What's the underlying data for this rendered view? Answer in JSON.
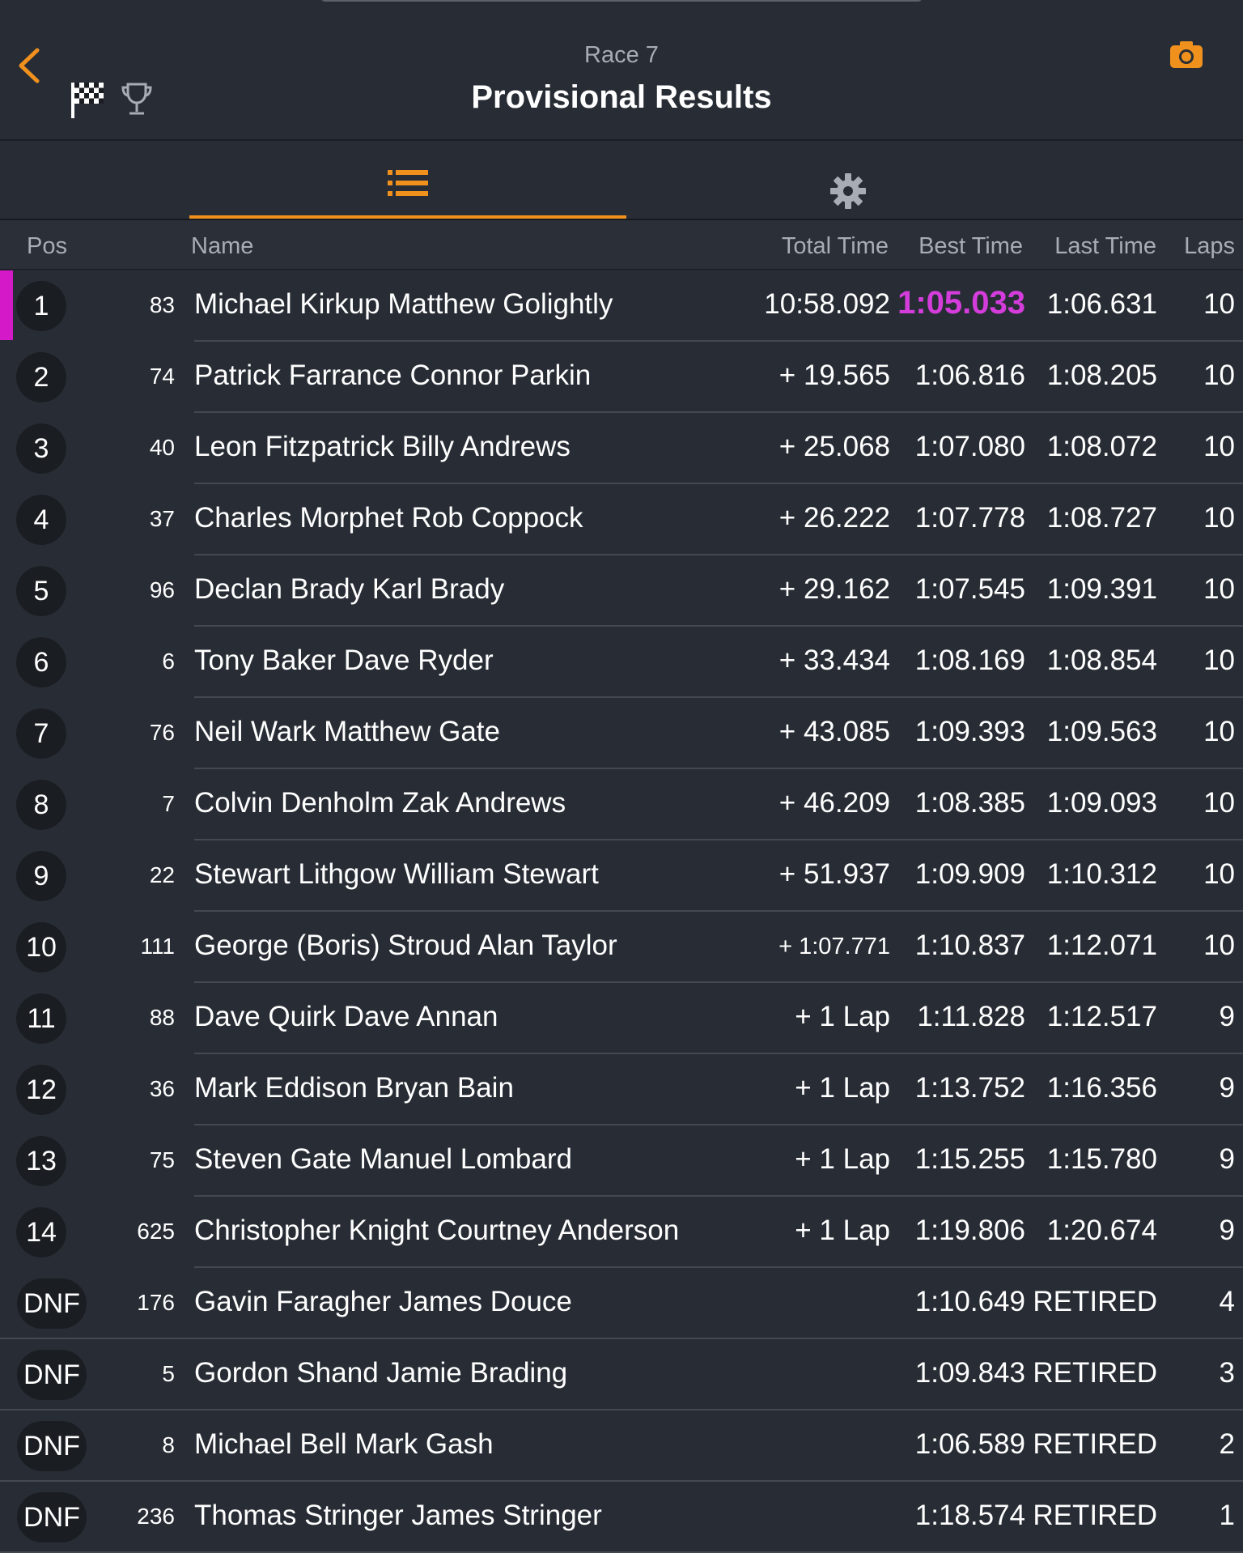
{
  "header": {
    "subtitle": "Race 7",
    "title": "Provisional Results"
  },
  "colors": {
    "accent": "#f0911e",
    "fastest": "#d43ddb",
    "background": "#282d35"
  },
  "icons": {
    "back": "chevron-left-icon",
    "flag": "checkered-flag-icon",
    "trophy": "trophy-icon",
    "camera": "camera-icon",
    "list_tab": "list-icon",
    "settings_tab": "gear-icon"
  },
  "columns": {
    "pos": "Pos",
    "name": "Name",
    "total": "Total Time",
    "best": "Best Time",
    "last": "Last Time",
    "laps": "Laps"
  },
  "results": [
    {
      "pos": "1",
      "num": "83",
      "name": "Michael Kirkup Matthew Golightly",
      "total": "10:58.092",
      "best": "1:05.033",
      "last": "1:06.631",
      "laps": "10"
    },
    {
      "pos": "2",
      "num": "74",
      "name": "Patrick Farrance Connor Parkin",
      "total": "+ 19.565",
      "best": "1:06.816",
      "last": "1:08.205",
      "laps": "10"
    },
    {
      "pos": "3",
      "num": "40",
      "name": "Leon Fitzpatrick Billy Andrews",
      "total": "+ 25.068",
      "best": "1:07.080",
      "last": "1:08.072",
      "laps": "10"
    },
    {
      "pos": "4",
      "num": "37",
      "name": "Charles Morphet Rob Coppock",
      "total": "+ 26.222",
      "best": "1:07.778",
      "last": "1:08.727",
      "laps": "10"
    },
    {
      "pos": "5",
      "num": "96",
      "name": "Declan Brady Karl Brady",
      "total": "+ 29.162",
      "best": "1:07.545",
      "last": "1:09.391",
      "laps": "10"
    },
    {
      "pos": "6",
      "num": "6",
      "name": "Tony Baker Dave Ryder",
      "total": "+ 33.434",
      "best": "1:08.169",
      "last": "1:08.854",
      "laps": "10"
    },
    {
      "pos": "7",
      "num": "76",
      "name": "Neil Wark Matthew Gate",
      "total": "+ 43.085",
      "best": "1:09.393",
      "last": "1:09.563",
      "laps": "10"
    },
    {
      "pos": "8",
      "num": "7",
      "name": "Colvin Denholm Zak Andrews",
      "total": "+ 46.209",
      "best": "1:08.385",
      "last": "1:09.093",
      "laps": "10"
    },
    {
      "pos": "9",
      "num": "22",
      "name": "Stewart Lithgow William Stewart",
      "total": "+ 51.937",
      "best": "1:09.909",
      "last": "1:10.312",
      "laps": "10"
    },
    {
      "pos": "10",
      "num": "111",
      "name": "George (Boris) Stroud Alan Taylor",
      "total": "+ 1:07.771",
      "best": "1:10.837",
      "last": "1:12.071",
      "laps": "10"
    },
    {
      "pos": "11",
      "num": "88",
      "name": "Dave Quirk Dave Annan",
      "total": "+ 1 Lap",
      "best": "1:11.828",
      "last": "1:12.517",
      "laps": "9"
    },
    {
      "pos": "12",
      "num": "36",
      "name": "Mark Eddison Bryan Bain",
      "total": "+ 1 Lap",
      "best": "1:13.752",
      "last": "1:16.356",
      "laps": "9"
    },
    {
      "pos": "13",
      "num": "75",
      "name": "Steven Gate Manuel Lombard",
      "total": "+ 1 Lap",
      "best": "1:15.255",
      "last": "1:15.780",
      "laps": "9"
    },
    {
      "pos": "14",
      "num": "625",
      "name": "Christopher Knight Courtney Anderson",
      "total": "+ 1 Lap",
      "best": "1:19.806",
      "last": "1:20.674",
      "laps": "9"
    },
    {
      "pos": "DNF",
      "num": "176",
      "name": "Gavin Faragher James Douce",
      "total": "",
      "best": "1:10.649",
      "last": "RETIRED",
      "laps": "4"
    },
    {
      "pos": "DNF",
      "num": "5",
      "name": "Gordon Shand Jamie Brading",
      "total": "",
      "best": "1:09.843",
      "last": "RETIRED",
      "laps": "3"
    },
    {
      "pos": "DNF",
      "num": "8",
      "name": "Michael Bell Mark Gash",
      "total": "",
      "best": "1:06.589",
      "last": "RETIRED",
      "laps": "2"
    },
    {
      "pos": "DNF",
      "num": "236",
      "name": "Thomas Stringer James Stringer",
      "total": "",
      "best": "1:18.574",
      "last": "RETIRED",
      "laps": "1"
    }
  ]
}
